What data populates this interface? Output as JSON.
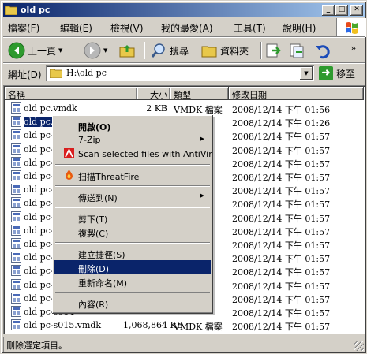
{
  "window": {
    "title": "old pc"
  },
  "menubar": {
    "items": [
      "檔案(F)",
      "編輯(E)",
      "檢視(V)",
      "我的最愛(A)",
      "工具(T)",
      "說明(H)"
    ]
  },
  "toolbar": {
    "back_label": "上一頁",
    "search_label": "搜尋",
    "folders_label": "資料夾"
  },
  "address": {
    "label": "網址(D)",
    "path": "H:\\old pc",
    "go_label": "移至"
  },
  "columns": {
    "name": "名稱",
    "size": "大小",
    "type": "類型",
    "modified": "修改日期"
  },
  "files": [
    {
      "name": "old pc.vmdk",
      "size": "2 KB",
      "type": "VMDK 檔案",
      "modified": "2008/12/14 下午 01:56"
    },
    {
      "name": "old pc.vmx",
      "size": "",
      "type": "",
      "modified": "2008/12/14 下午 01:26"
    },
    {
      "name": "old pc-s001",
      "size": "",
      "type": "",
      "modified": "2008/12/14 下午 01:57"
    },
    {
      "name": "old pc-s002",
      "size": "",
      "type": "",
      "modified": "2008/12/14 下午 01:57"
    },
    {
      "name": "old pc-s003",
      "size": "",
      "type": "",
      "modified": "2008/12/14 下午 01:57"
    },
    {
      "name": "old pc-s004",
      "size": "",
      "type": "",
      "modified": "2008/12/14 下午 01:57"
    },
    {
      "name": "old pc-s005",
      "size": "",
      "type": "",
      "modified": "2008/12/14 下午 01:57"
    },
    {
      "name": "old pc-s006",
      "size": "",
      "type": "",
      "modified": "2008/12/14 下午 01:57"
    },
    {
      "name": "old pc-s007",
      "size": "",
      "type": "",
      "modified": "2008/12/14 下午 01:57"
    },
    {
      "name": "old pc-s008",
      "size": "",
      "type": "",
      "modified": "2008/12/14 下午 01:57"
    },
    {
      "name": "old pc-s009",
      "size": "",
      "type": "",
      "modified": "2008/12/14 下午 01:57"
    },
    {
      "name": "old pc-s010",
      "size": "",
      "type": "",
      "modified": "2008/12/14 下午 01:57"
    },
    {
      "name": "old pc-s011",
      "size": "",
      "type": "",
      "modified": "2008/12/14 下午 01:57"
    },
    {
      "name": "old pc-s012",
      "size": "",
      "type": "",
      "modified": "2008/12/14 下午 01:57"
    },
    {
      "name": "old pc-s013",
      "size": "",
      "type": "",
      "modified": "2008/12/14 下午 01:57"
    },
    {
      "name": "old pc-s014",
      "size": "",
      "type": "",
      "modified": "2008/12/14 下午 01:57"
    },
    {
      "name": "old pc-s015.vmdk",
      "size": "1,068,864 KB",
      "type": "VMDK 檔案",
      "modified": "2008/12/14 下午 01:57"
    }
  ],
  "context_menu": {
    "open": "開啟(O)",
    "zip": "7-Zip",
    "antivir": "Scan selected files with AntiVir",
    "threatfire": "扫描ThreatFire",
    "send_to": "傳送到(N)",
    "cut": "剪下(T)",
    "copy": "複製(C)",
    "shortcut": "建立捷徑(S)",
    "delete": "刪除(D)",
    "rename": "重新命名(M)",
    "properties": "內容(R)"
  },
  "status": {
    "text": "刪除選定項目。"
  },
  "colors": {
    "titlebar": "#0a246a",
    "selection": "#0a246a",
    "face": "#d4d0c8"
  }
}
